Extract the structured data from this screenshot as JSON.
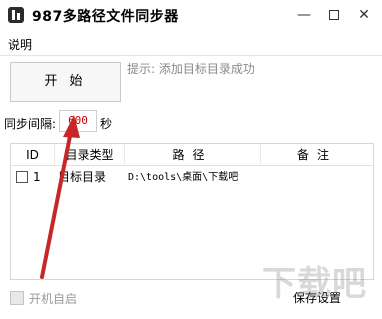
{
  "window": {
    "title": "987多路径文件同步器",
    "controls": {
      "minimize": "—",
      "close": "✕"
    }
  },
  "menu": {
    "items": [
      "说明"
    ]
  },
  "start_button": {
    "label": "开 始"
  },
  "hint": {
    "text": "提示: 添加目标目录成功"
  },
  "interval": {
    "label": "同步间隔:",
    "value": "600",
    "unit": "秒"
  },
  "table": {
    "headers": {
      "id": "ID",
      "type": "目录类型",
      "path": "路径",
      "note": "备注"
    },
    "rows": [
      {
        "id": "1",
        "type": "目标目录",
        "path": "D:\\tools\\桌面\\下载吧",
        "note": ""
      }
    ]
  },
  "autostart": {
    "label": "开机自启",
    "checked": false,
    "enabled": false
  },
  "save_button": {
    "label": "保存设置"
  },
  "watermark": {
    "text": "下载吧"
  },
  "colors": {
    "interval_value": "#cc0000",
    "annotation_arrow": "#c62828",
    "hint_text": "#8a8a8a"
  }
}
